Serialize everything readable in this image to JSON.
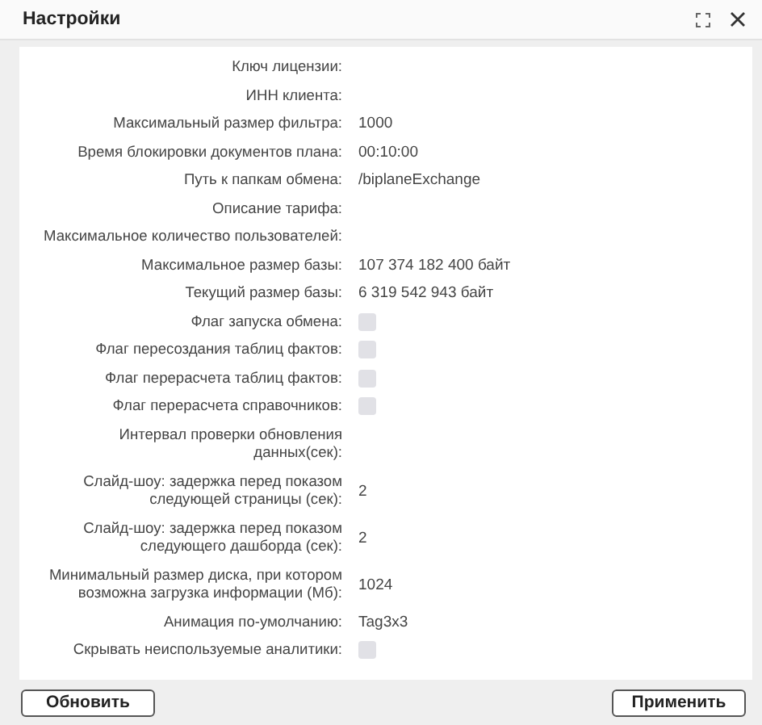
{
  "window": {
    "title": "Настройки"
  },
  "fields": [
    {
      "kind": "text",
      "label": "Ключ лицензии:"
    },
    {
      "kind": "text",
      "label": "ИНН клиента:"
    },
    {
      "kind": "text",
      "label": "Максимальный размер фильтра:",
      "value": "1000"
    },
    {
      "kind": "text",
      "label": "Время блокировки документов плана:",
      "value": "00:10:00"
    },
    {
      "kind": "text",
      "label": "Путь к папкам обмена:",
      "value": "/biplaneExchange"
    },
    {
      "kind": "text",
      "label": "Описание тарифа:"
    },
    {
      "kind": "text",
      "label": "Максимальное количество пользователей:"
    },
    {
      "kind": "text",
      "label": "Максимальное размер базы:",
      "value": "107 374 182 400 байт"
    },
    {
      "kind": "text",
      "label": "Текущий размер базы:",
      "value": "6 319 542 943 байт"
    },
    {
      "kind": "checkbox",
      "label": "Флаг запуска обмена:",
      "checked": false
    },
    {
      "kind": "checkbox",
      "label": "Флаг пересоздания таблиц фактов:",
      "checked": false
    },
    {
      "kind": "checkbox",
      "label": "Флаг перерасчета таблиц фактов:",
      "checked": false
    },
    {
      "kind": "checkbox",
      "label": "Флаг перерасчета справочников:",
      "checked": false
    },
    {
      "kind": "text",
      "label": "Интервал проверки обновления\nданных(сек):"
    },
    {
      "kind": "text",
      "label": "Слайд-шоу: задержка перед показом\nследующей страницы (сек):",
      "value": "2"
    },
    {
      "kind": "text",
      "label": "Слайд-шоу: задержка перед показом\nследующего дашборда (сек):",
      "value": "2"
    },
    {
      "kind": "text",
      "label": "Минимальный размер диска, при котором\nвозможна загрузка информации (Мб):",
      "value": "1024"
    },
    {
      "kind": "text",
      "label": "Анимация по-умолчанию:",
      "value": "Tag3x3"
    },
    {
      "kind": "checkbox",
      "label": "Скрывать неиспользуемые аналитики:",
      "checked": false
    }
  ],
  "buttons": [
    "Обновить",
    "Применить"
  ]
}
